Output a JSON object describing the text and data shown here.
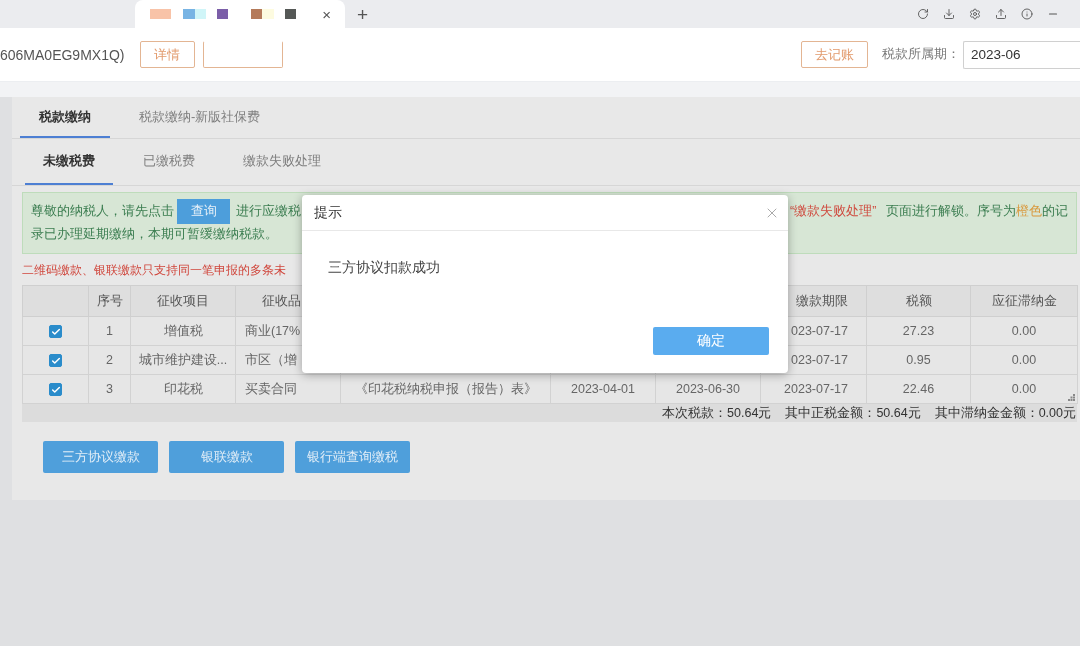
{
  "browser": {
    "tab_close": "×",
    "new_tab": "+"
  },
  "header": {
    "title": "606MA0EG9MX1Q)",
    "buttons": [
      {
        "label": "详情",
        "clipped": false
      },
      {
        "clipped": true
      }
    ],
    "bookkeeping": "去记账",
    "period": {
      "label": "税款所属期：",
      "value": "2023-06"
    }
  },
  "tabs": [
    {
      "label": "税款缴纳",
      "selected": true
    },
    {
      "label": "税款缴纳-新版社保费",
      "selected": false
    }
  ],
  "subtabs": [
    {
      "label": "未缴税费",
      "selected": true
    },
    {
      "label": "已缴税费",
      "selected": false
    },
    {
      "label": "缴款失败处理",
      "selected": false
    }
  ],
  "notice": {
    "before_button": "尊敬的纳税人，请先点击",
    "button": "查询",
    "after_button": "进行应缴税",
    "continued": [
      {
        "kind": "alert",
        "text": "“缴款失败处理”"
      },
      {
        "kind": "plain",
        "text": "页面进行解锁。序号为"
      },
      {
        "kind": "highlight",
        "text": "橙色"
      },
      {
        "kind": "plain",
        "text": "的记"
      }
    ],
    "line_2": "录已办理延期缴纳，本期可暂缓缴纳税款。"
  },
  "warning": "二维码缴款、银联缴款只支持同一笔申报的多条未",
  "table": {
    "columns": [
      "序号",
      "征收项目",
      "征收品",
      null,
      null,
      null,
      "缴款期限",
      "税额",
      "应征滞纳金"
    ],
    "rows": [
      {
        "checked": true,
        "cells": [
          "1",
          "增值税",
          "商业(17%",
          null,
          null,
          null,
          "023-07-17",
          "27.23",
          "0.00"
        ]
      },
      {
        "checked": true,
        "cells": [
          "2",
          "城市维护建设...",
          "市区（增",
          null,
          null,
          null,
          "023-07-17",
          "0.95",
          "0.00"
        ]
      },
      {
        "checked": true,
        "cells": [
          "3",
          "印花税",
          "买卖合同",
          "《印花税纳税申报（报告）表》",
          "2023-04-01",
          "2023-06-30",
          "2023-07-17",
          "22.46",
          "0.00"
        ]
      }
    ]
  },
  "totals": [
    "本次税款：50.64元",
    "其中正税金额：50.64元",
    "其中滞纳金金额：0.00元"
  ],
  "actions": [
    "三方协议缴款",
    "银联缴款",
    "银行端查询缴税"
  ],
  "dialog": {
    "title": "提示",
    "message": "三方协议扣款成功",
    "confirm": "确定"
  }
}
